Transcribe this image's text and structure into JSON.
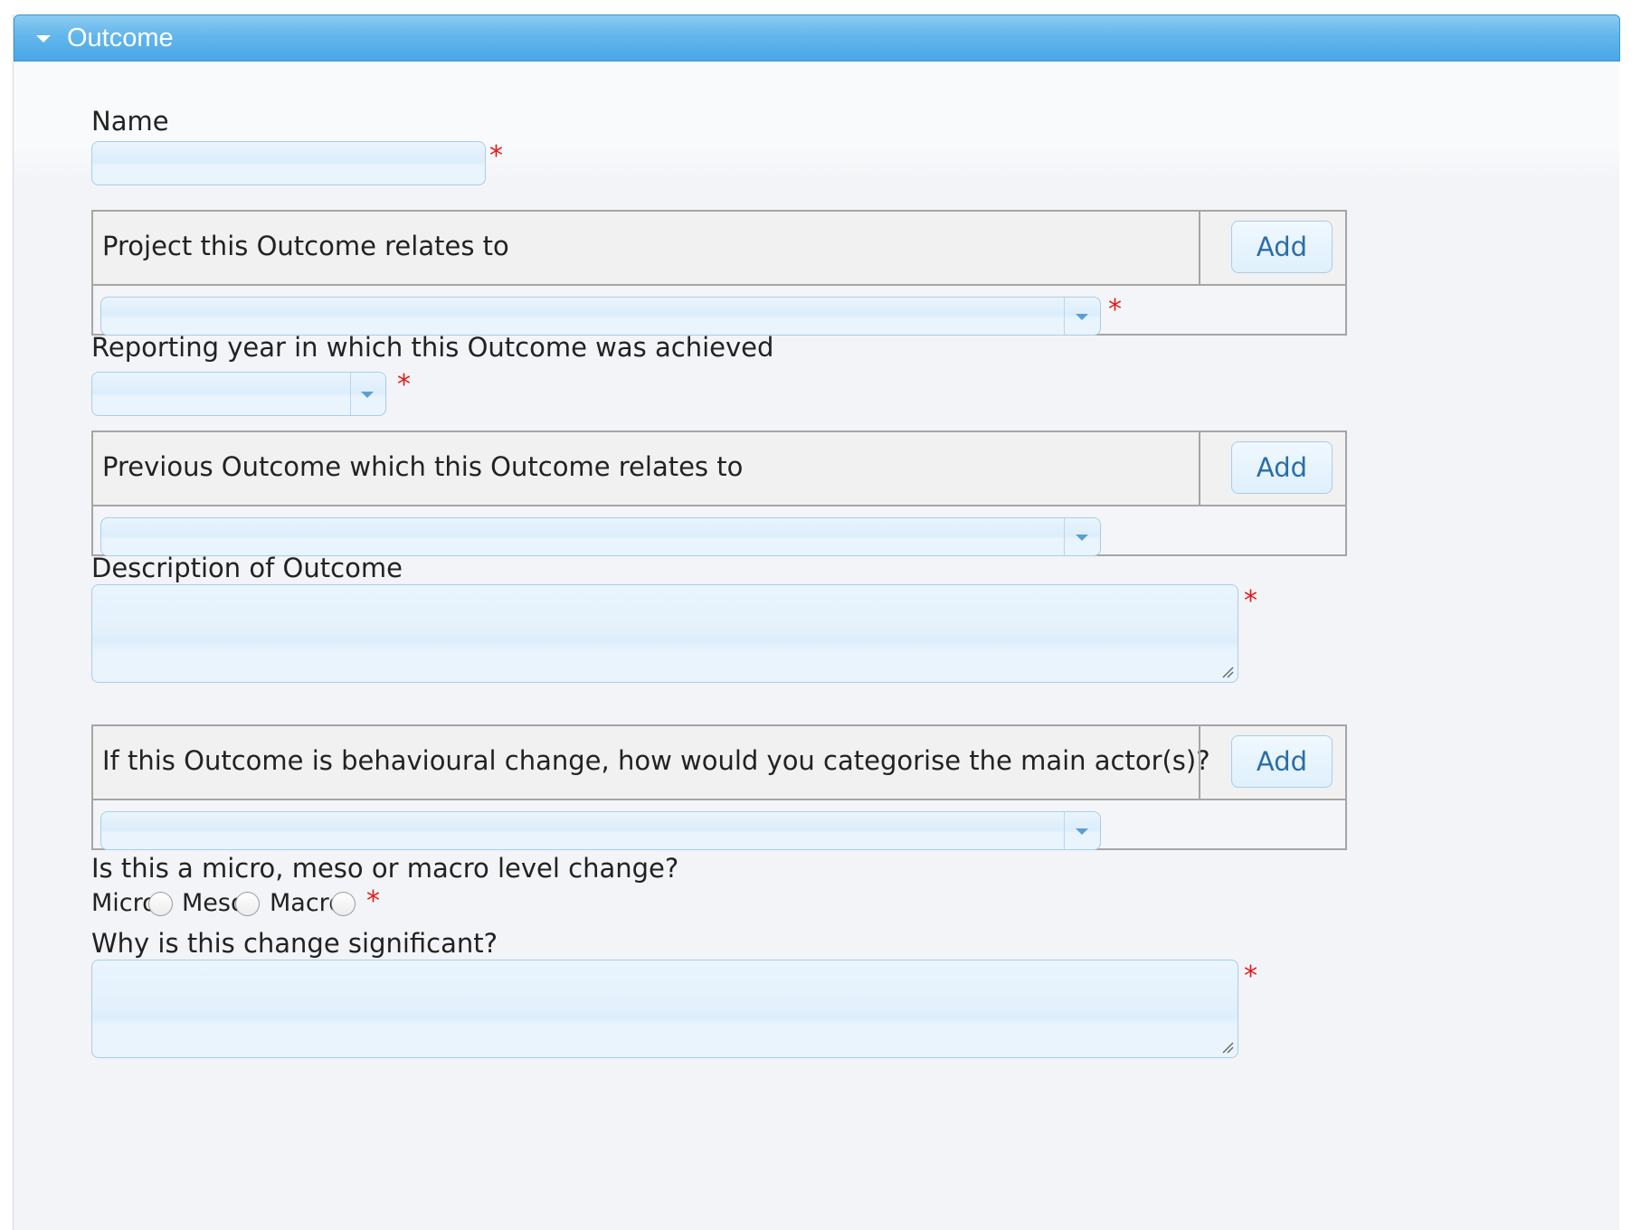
{
  "panel": {
    "title": "Outcome",
    "collapse_icon": "triangle-down-icon"
  },
  "form": {
    "name_label": "Name",
    "project_label": "Project this Outcome relates to",
    "reporting_year_label": "Reporting year in which this Outcome was achieved",
    "previous_outcome_label": "Previous Outcome which this Outcome relates to",
    "description_label": "Description of Outcome",
    "actor_label": "If this Outcome is behavioural change, how would you categorise the main actor(s)?",
    "level_label": "Is this a micro, meso or macro level change?",
    "level_options": [
      "Micro",
      "Meso",
      "Macro"
    ],
    "significance_label": "Why is this change significant?",
    "add_label": "Add",
    "required_marker": "*"
  },
  "colors": {
    "header": "#4aa8e6",
    "required": "#e31b1b",
    "add_text": "#2a6ea8",
    "input_border": "#a9cde7"
  }
}
